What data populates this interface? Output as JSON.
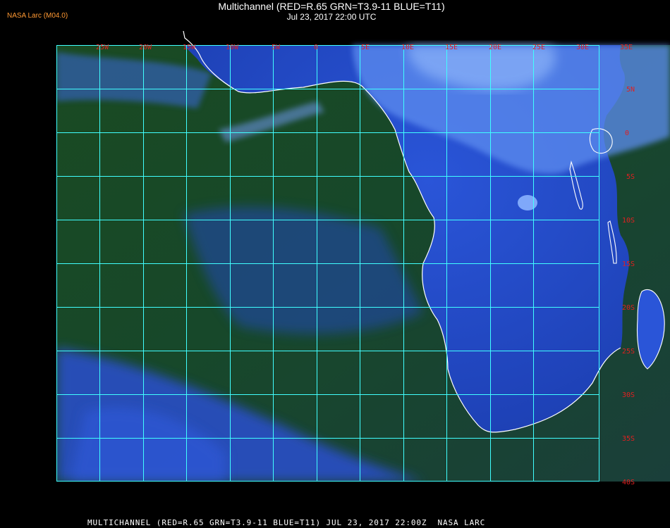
{
  "brand": {
    "label": "NASA Larc (M04.0)",
    "color": "#ff9933"
  },
  "header": {
    "title": "Multichannel (RED=R.65 GRN=T3.9-11 BLUE=T11)",
    "datetime": "Jul 23, 2017 22:00 UTC"
  },
  "map": {
    "grid_color": "#40ffff",
    "label_color": "#e02020",
    "coast_color": "#ffffff",
    "longitude_labels": [
      "25W",
      "20W",
      "15W",
      "10W",
      "5W",
      "0",
      "5E",
      "10E",
      "15E",
      "20E",
      "25E",
      "30E",
      "35E"
    ],
    "latitude_labels": [
      "5N",
      "0",
      "5S",
      "10S",
      "15S",
      "20S",
      "25S",
      "30S",
      "35S",
      "40S"
    ]
  },
  "footer": {
    "caption": "MULTICHANNEL (RED=R.65 GRN=T3.9-11 BLUE=T11) JUL 23, 2017 22:00Z  NASA LARC"
  }
}
